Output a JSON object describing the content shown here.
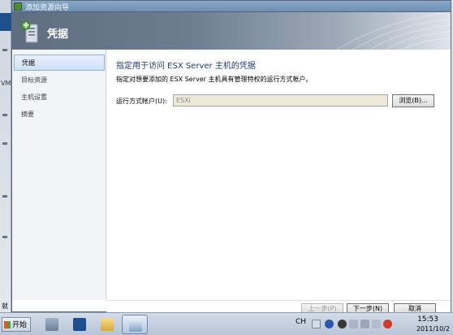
{
  "background": {
    "side_label": "VM",
    "bottom_label": "就"
  },
  "window": {
    "title": "添加资源向导",
    "banner_title": "凭据"
  },
  "nav": {
    "items": [
      {
        "label": "凭据",
        "active": true
      },
      {
        "label": "目标资源",
        "active": false
      },
      {
        "label": "主机设置",
        "active": false
      },
      {
        "label": "摘要",
        "active": false
      }
    ]
  },
  "content": {
    "heading": "指定用于访问 ESX Server 主机的凭据",
    "description": "指定对想要添加的 ESX Server 主机具有管理特权的运行方式帐户。",
    "runas_label": "运行方式帐户(U):",
    "runas_value": "ESXi",
    "browse_label": "浏览(B)..."
  },
  "footer": {
    "prev_label": "上一步(P)",
    "next_label": "下一步(N)",
    "cancel_label": "取消"
  },
  "taskbar": {
    "start_label": "开始",
    "lang": "CH",
    "time": "15:53",
    "date": "2011/10/2"
  },
  "colors": {
    "heading": "#1c3b73",
    "nav_active_border": "#8fb2d9",
    "banner_dark": "#5e6e80"
  }
}
